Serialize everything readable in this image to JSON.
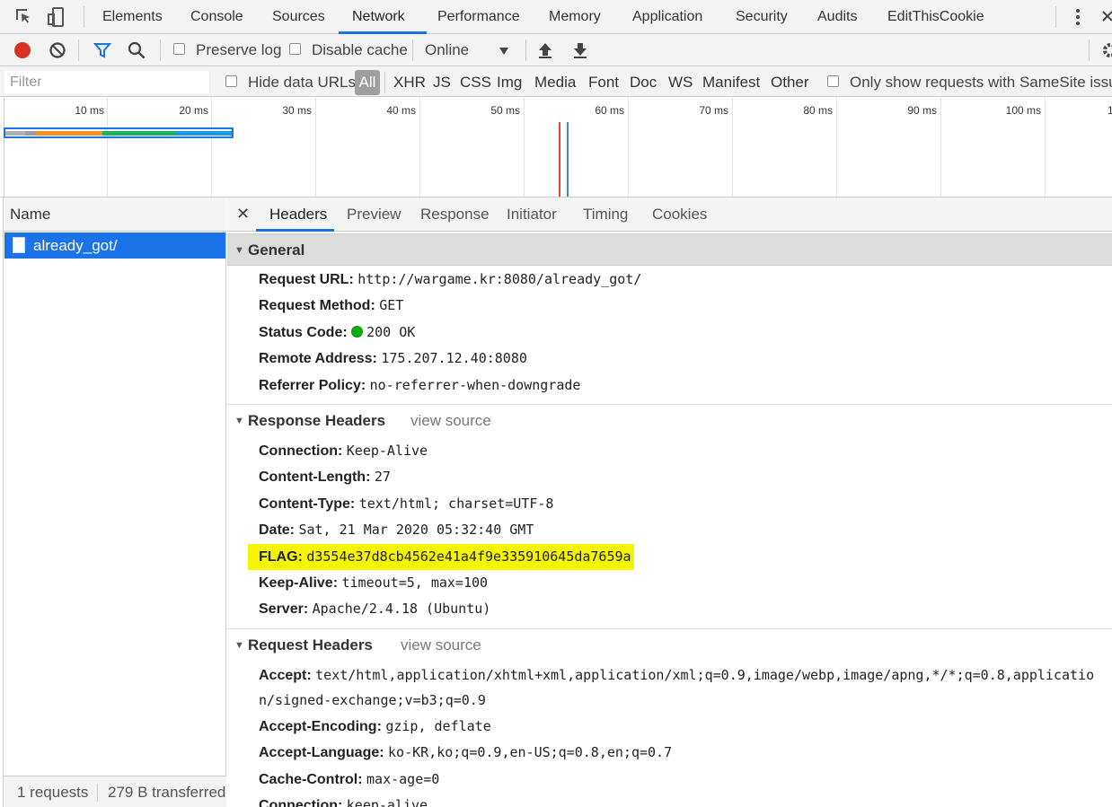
{
  "main_tabs": [
    "Elements",
    "Console",
    "Sources",
    "Network",
    "Performance",
    "Memory",
    "Application",
    "Security",
    "Audits",
    "EditThisCookie"
  ],
  "active_main_tab": "Network",
  "toolbar": {
    "preserve_log": "Preserve log",
    "disable_cache": "Disable cache",
    "throttle": "Online"
  },
  "filter": {
    "placeholder": "Filter",
    "hide_data_urls": "Hide data URLs",
    "types": [
      "All",
      "XHR",
      "JS",
      "CSS",
      "Img",
      "Media",
      "Font",
      "Doc",
      "WS",
      "Manifest",
      "Other"
    ],
    "samesite": "Only show requests with SameSite issues"
  },
  "timeline": {
    "ticks": [
      "10 ms",
      "20 ms",
      "30 ms",
      "40 ms",
      "50 ms",
      "60 ms",
      "70 ms",
      "80 ms",
      "90 ms",
      "100 ms",
      "1"
    ]
  },
  "requests": {
    "header": "Name",
    "items": [
      {
        "name": "already_got/"
      }
    ],
    "status_count": "1 requests",
    "status_transferred": "279 B transferred"
  },
  "detail_tabs": [
    "Headers",
    "Preview",
    "Response",
    "Initiator",
    "Timing",
    "Cookies"
  ],
  "general": {
    "title": "General",
    "rows": [
      {
        "key": "Request URL:",
        "value": "http://wargame.kr:8080/already_got/"
      },
      {
        "key": "Request Method:",
        "value": "GET"
      },
      {
        "key": "Status Code:",
        "value": "200 OK"
      },
      {
        "key": "Remote Address:",
        "value": "175.207.12.40:8080"
      },
      {
        "key": "Referrer Policy:",
        "value": "no-referrer-when-downgrade"
      }
    ]
  },
  "response_headers": {
    "title": "Response Headers",
    "view_source": "view source",
    "rows": [
      {
        "key": "Connection:",
        "value": "Keep-Alive"
      },
      {
        "key": "Content-Length:",
        "value": "27"
      },
      {
        "key": "Content-Type:",
        "value": "text/html; charset=UTF-8"
      },
      {
        "key": "Date:",
        "value": "Sat, 21 Mar 2020 05:32:40 GMT"
      },
      {
        "key": "FLAG:",
        "value": "d3554e37d8cb4562e41a4f9e335910645da7659a"
      },
      {
        "key": "Keep-Alive:",
        "value": "timeout=5, max=100"
      },
      {
        "key": "Server:",
        "value": "Apache/2.4.18 (Ubuntu)"
      }
    ]
  },
  "request_headers": {
    "title": "Request Headers",
    "view_source": "view source",
    "rows": [
      {
        "key": "Accept:",
        "value": "text/html,application/xhtml+xml,application/xml;q=0.9,image/webp,image/apng,*/*;q=0.8,applicatio"
      },
      {
        "key": "",
        "value": "n/signed-exchange;v=b3;q=0.9"
      },
      {
        "key": "Accept-Encoding:",
        "value": "gzip, deflate"
      },
      {
        "key": "Accept-Language:",
        "value": "ko-KR,ko;q=0.9,en-US;q=0.8,en;q=0.7"
      },
      {
        "key": "Cache-Control:",
        "value": "max-age=0"
      },
      {
        "key": "Connection:",
        "value": "keep-alive"
      }
    ]
  },
  "colors": {
    "accent": "#1a73e8",
    "record": "#d93025",
    "highlight": "#f5f500",
    "status_ok": "#0ab00a"
  }
}
